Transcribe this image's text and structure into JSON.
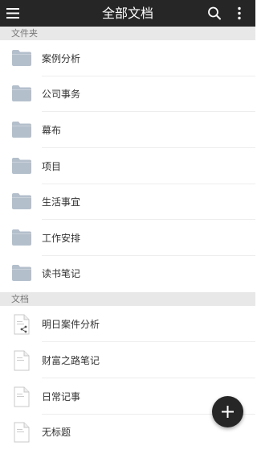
{
  "header": {
    "title": "全部文档",
    "menu_icon": "hamburger-menu-icon",
    "search_icon": "search-icon",
    "more_icon": "more-vertical-icon"
  },
  "sections": {
    "folders_label": "文件夹",
    "documents_label": "文档"
  },
  "folders": [
    {
      "label": "案例分析"
    },
    {
      "label": "公司事务"
    },
    {
      "label": "幕布"
    },
    {
      "label": "项目"
    },
    {
      "label": "生活事宜"
    },
    {
      "label": "工作安排"
    },
    {
      "label": "读书笔记"
    }
  ],
  "documents": [
    {
      "label": "明日案件分析",
      "shared": true
    },
    {
      "label": "财富之路笔记",
      "shared": false
    },
    {
      "label": "日常记事",
      "shared": false
    },
    {
      "label": "无标题",
      "shared": false
    }
  ],
  "fab": {
    "icon": "plus-icon"
  },
  "colors": {
    "appbar": "#262626",
    "folder": "#b4bfcc",
    "section_bg": "#e8e8e8"
  }
}
